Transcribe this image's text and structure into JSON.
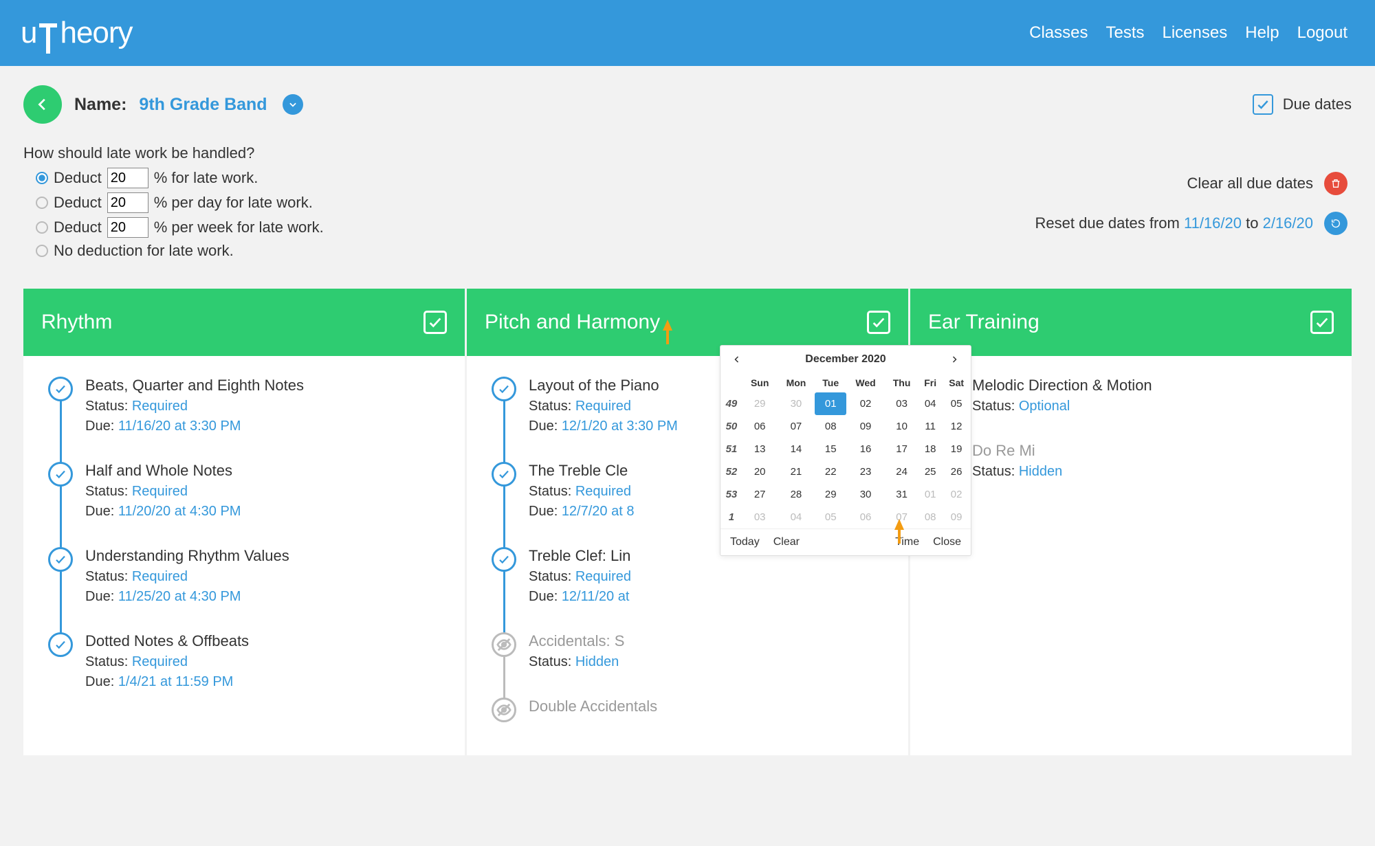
{
  "nav": {
    "logo": "uTheory",
    "items": [
      "Classes",
      "Tests",
      "Licenses",
      "Help",
      "Logout"
    ]
  },
  "header": {
    "name_label": "Name:",
    "name_value": "9th Grade Band",
    "due_dates_label": "Due dates"
  },
  "late_work": {
    "question": "How should late work be handled?",
    "opts": [
      {
        "before": "Deduct ",
        "pct": "20",
        "after": "% for late work.",
        "checked": true
      },
      {
        "before": "Deduct ",
        "pct": "20",
        "after": "% per day for late work.",
        "checked": false
      },
      {
        "before": "Deduct ",
        "pct": "20",
        "after": "% per week for late work.",
        "checked": false
      },
      {
        "before": "No deduction for late work.",
        "pct": null
      }
    ]
  },
  "actions": {
    "clear_label": "Clear all due dates",
    "reset_prefix": "Reset due dates from ",
    "reset_from": "11/16/20",
    "reset_to_word": " to  ",
    "reset_to": "2/16/20"
  },
  "columns": [
    {
      "title": "Rhythm",
      "items": [
        {
          "title": "Beats, Quarter and Eighth Notes",
          "status": "Required",
          "due": "11/16/20 at 3:30 PM",
          "node": "check"
        },
        {
          "title": "Half and Whole Notes",
          "status": "Required",
          "due": "11/20/20 at 4:30 PM",
          "node": "check"
        },
        {
          "title": "Understanding Rhythm Values",
          "status": "Required",
          "due": "11/25/20 at 4:30 PM",
          "node": "check"
        },
        {
          "title": "Dotted Notes & Offbeats",
          "status": "Required",
          "due": "1/4/21 at 11:59 PM",
          "node": "check"
        }
      ]
    },
    {
      "title": "Pitch and Harmony",
      "items": [
        {
          "title": "Layout of the Piano",
          "status": "Required",
          "due": "12/1/20 at 3:30 PM",
          "node": "check"
        },
        {
          "title": "The Treble Cle",
          "status": "Required",
          "due": "12/7/20 at 8",
          "node": "check"
        },
        {
          "title": "Treble Clef: Lin",
          "status": "Required",
          "due": "12/11/20 at",
          "node": "check"
        },
        {
          "title": "Accidentals: S",
          "status": "Hidden",
          "due": null,
          "node": "eye",
          "muted": true
        },
        {
          "title": "Double Accidentals",
          "status": null,
          "due": null,
          "node": "eye",
          "muted": true
        }
      ]
    },
    {
      "title": "Ear Training",
      "items": [
        {
          "title": "Melodic Direction & Motion",
          "status": "Optional",
          "due": null,
          "node": "empty"
        },
        {
          "title": "Do Re Mi",
          "status": "Hidden",
          "due": null,
          "node": "eye",
          "muted": true
        }
      ]
    }
  ],
  "labels": {
    "status_prefix": "Status: ",
    "due_prefix": "Due: "
  },
  "calendar": {
    "month_label": "December 2020",
    "weekday_header": [
      "",
      "Sun",
      "Mon",
      "Tue",
      "Wed",
      "Thu",
      "Fri",
      "Sat"
    ],
    "rows": [
      {
        "wk": "49",
        "days": [
          {
            "d": "29",
            "dim": true
          },
          {
            "d": "30",
            "dim": true
          },
          {
            "d": "01",
            "sel": true
          },
          {
            "d": "02"
          },
          {
            "d": "03"
          },
          {
            "d": "04"
          },
          {
            "d": "05"
          }
        ]
      },
      {
        "wk": "50",
        "days": [
          {
            "d": "06"
          },
          {
            "d": "07"
          },
          {
            "d": "08"
          },
          {
            "d": "09"
          },
          {
            "d": "10"
          },
          {
            "d": "11"
          },
          {
            "d": "12"
          }
        ]
      },
      {
        "wk": "51",
        "days": [
          {
            "d": "13"
          },
          {
            "d": "14"
          },
          {
            "d": "15"
          },
          {
            "d": "16"
          },
          {
            "d": "17"
          },
          {
            "d": "18"
          },
          {
            "d": "19"
          }
        ]
      },
      {
        "wk": "52",
        "days": [
          {
            "d": "20"
          },
          {
            "d": "21"
          },
          {
            "d": "22"
          },
          {
            "d": "23"
          },
          {
            "d": "24"
          },
          {
            "d": "25"
          },
          {
            "d": "26"
          }
        ]
      },
      {
        "wk": "53",
        "days": [
          {
            "d": "27"
          },
          {
            "d": "28"
          },
          {
            "d": "29"
          },
          {
            "d": "30"
          },
          {
            "d": "31"
          },
          {
            "d": "01",
            "dim": true
          },
          {
            "d": "02",
            "dim": true
          }
        ]
      },
      {
        "wk": "1",
        "days": [
          {
            "d": "03",
            "dim": true
          },
          {
            "d": "04",
            "dim": true
          },
          {
            "d": "05",
            "dim": true
          },
          {
            "d": "06",
            "dim": true
          },
          {
            "d": "07",
            "dim": true
          },
          {
            "d": "08",
            "dim": true
          },
          {
            "d": "09",
            "dim": true
          }
        ]
      }
    ],
    "footer": {
      "today": "Today",
      "clear": "Clear",
      "time": "Time",
      "close": "Close"
    }
  }
}
